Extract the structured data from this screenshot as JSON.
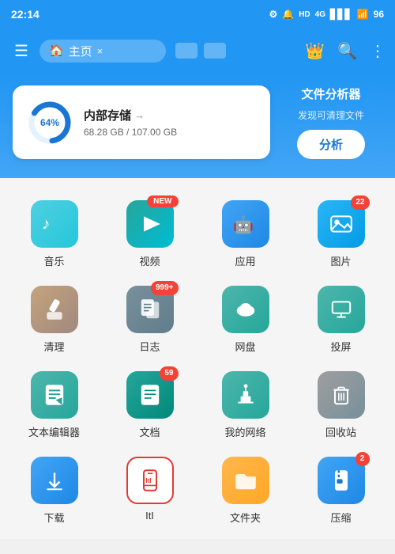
{
  "statusBar": {
    "time": "22:14",
    "icons": [
      "settings",
      "notification",
      "hd",
      "4g",
      "signal",
      "wifi",
      "battery"
    ],
    "battery": "96"
  },
  "toolbar": {
    "homeLabel": "主页",
    "closeLabel": "×",
    "crownIcon": "👑",
    "searchIcon": "🔍",
    "moreIcon": "⋮",
    "menuIcon": "☰"
  },
  "storage": {
    "title": "内部存储",
    "percent": "64%",
    "used": "68.28 GB / 107.00 GB",
    "donutPercent": 64
  },
  "analyzer": {
    "title": "文件分析器",
    "subtitle": "发现可清理文件",
    "buttonLabel": "分析"
  },
  "grid": [
    {
      "id": "music",
      "label": "音乐",
      "icon": "♪",
      "color": "ic-music",
      "badge": null,
      "badgeType": null
    },
    {
      "id": "video",
      "label": "视频",
      "icon": "▶",
      "color": "ic-video",
      "badge": "NEW",
      "badgeType": "new"
    },
    {
      "id": "app",
      "label": "应用",
      "icon": "🤖",
      "color": "ic-app",
      "badge": null,
      "badgeType": null
    },
    {
      "id": "photo",
      "label": "图片",
      "icon": "🖼",
      "color": "ic-photo",
      "badge": "22",
      "badgeType": "num"
    },
    {
      "id": "clean",
      "label": "清理",
      "icon": "🧹",
      "color": "ic-clean",
      "badge": null,
      "badgeType": null
    },
    {
      "id": "log",
      "label": "日志",
      "icon": "📋",
      "color": "ic-log",
      "badge": "999+",
      "badgeType": "num"
    },
    {
      "id": "cloud",
      "label": "网盘",
      "icon": "☁",
      "color": "ic-cloud",
      "badge": null,
      "badgeType": null
    },
    {
      "id": "cast",
      "label": "投屏",
      "icon": "📺",
      "color": "ic-cast",
      "badge": null,
      "badgeType": null
    },
    {
      "id": "text",
      "label": "文本编辑器",
      "icon": "📝",
      "color": "ic-text",
      "badge": null,
      "badgeType": null
    },
    {
      "id": "doc",
      "label": "文档",
      "icon": "📄",
      "color": "ic-doc",
      "badge": "59",
      "badgeType": "num"
    },
    {
      "id": "net",
      "label": "我的网络",
      "icon": "📡",
      "color": "ic-net",
      "badge": null,
      "badgeType": null
    },
    {
      "id": "trash",
      "label": "回收站",
      "icon": "🗑",
      "color": "ic-trash",
      "badge": null,
      "badgeType": null
    },
    {
      "id": "download",
      "label": "下载",
      "icon": "⬇",
      "color": "ic-dl",
      "badge": null,
      "badgeType": null
    },
    {
      "id": "phone",
      "label": "ItI",
      "icon": "📱",
      "color": "ic-phone",
      "badge": null,
      "badgeType": null
    },
    {
      "id": "folder",
      "label": "文件夹",
      "icon": "📁",
      "color": "ic-folder",
      "badge": null,
      "badgeType": null
    },
    {
      "id": "zip",
      "label": "压缩",
      "icon": "🗜",
      "color": "ic-zip",
      "badge": "2",
      "badgeType": "num"
    }
  ]
}
